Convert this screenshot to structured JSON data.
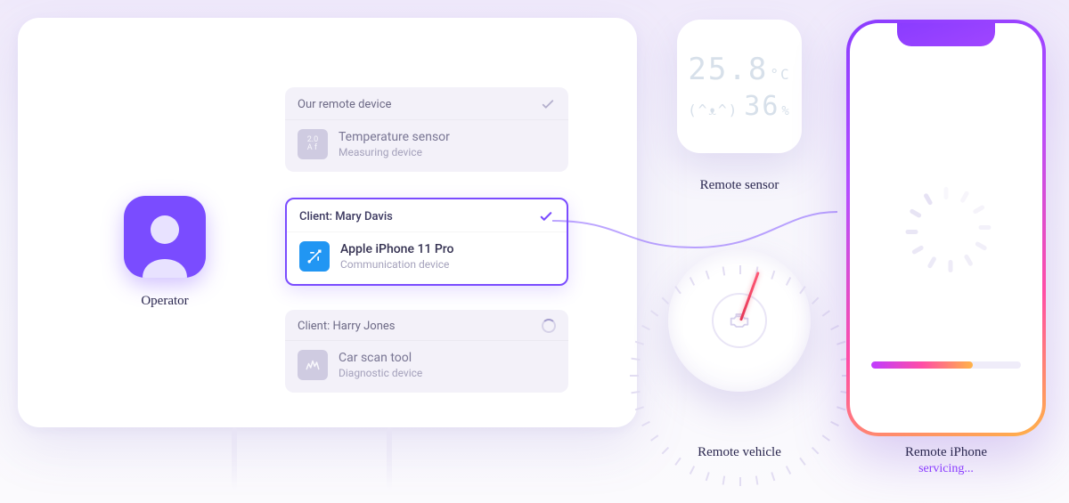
{
  "operator": {
    "label": "Operator"
  },
  "cards": [
    {
      "header": "Our remote device",
      "status": "check-grey",
      "device_name": "Temperature sensor",
      "device_type": "Measuring device",
      "icon_text": "2.0\nA f"
    },
    {
      "header": "Client: Mary Davis",
      "status": "check-purple",
      "device_name": "Apple iPhone 11 Pro",
      "device_type": "Communication device"
    },
    {
      "header": "Client: Harry Jones",
      "status": "loading",
      "device_name": "Car scan tool",
      "device_type": "Diagnostic device"
    }
  ],
  "sensor": {
    "temperature": "25.8",
    "temp_unit": "°C",
    "humidity": "36",
    "humidity_unit": "%",
    "face": "(^ᴥ^)",
    "caption": "Remote sensor"
  },
  "gauge": {
    "caption": "Remote vehicle"
  },
  "phone": {
    "caption": "Remote iPhone",
    "status": "servicing...",
    "progress_percent": 68
  }
}
